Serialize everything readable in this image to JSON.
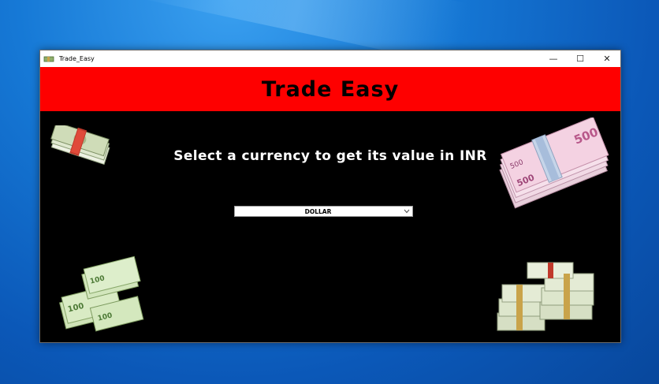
{
  "window": {
    "title": "Trade_Easy",
    "controls": {
      "minimize": "—",
      "maximize": "☐",
      "close": "✕"
    }
  },
  "header": {
    "title": "Trade Easy"
  },
  "main": {
    "prompt": "Select a currency to get its value in INR",
    "currency_select": {
      "value": "DOLLAR",
      "icon": "chevron-down-icon"
    }
  },
  "images": [
    "dollar-bundle-image",
    "euro-500-stack-image",
    "euro-100-stack-image",
    "dollar-stack-image"
  ],
  "colors": {
    "header_bg": "#fe0000",
    "content_bg": "#000000",
    "desktop": "#0b58b8"
  }
}
